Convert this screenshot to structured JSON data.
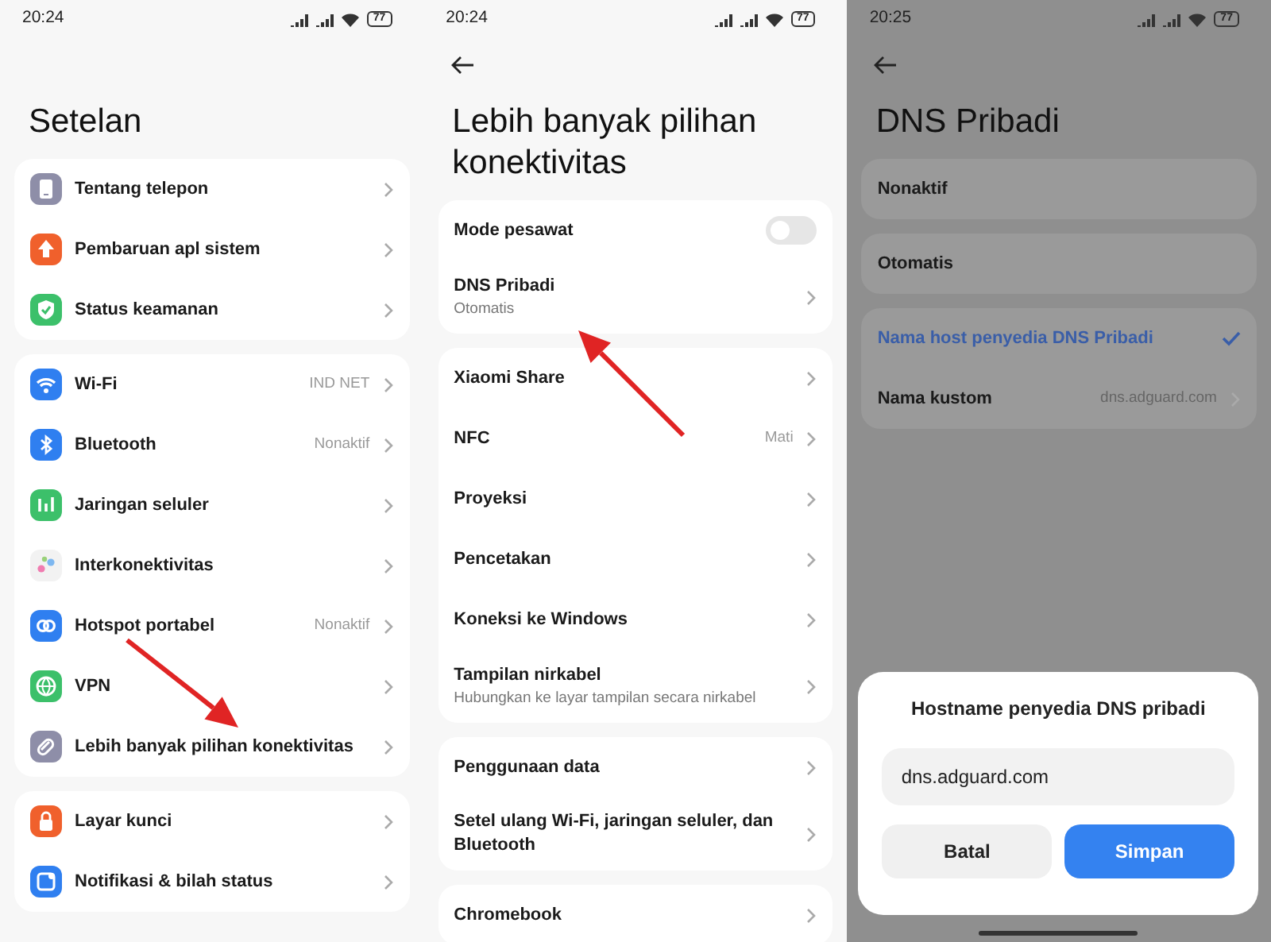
{
  "panels": [
    {
      "status_bar": {
        "time": "20:24",
        "battery": "77"
      },
      "title": "Setelan",
      "groups": [
        [
          {
            "kind": "link",
            "label": "Tentang telepon",
            "color": "#8e8ea8"
          },
          {
            "kind": "link",
            "label": "Pembaruan apl sistem",
            "color": "#f0602c"
          },
          {
            "kind": "link",
            "label": "Status keamanan",
            "color": "#3cc06a"
          }
        ],
        [
          {
            "kind": "link",
            "label": "Wi-Fi",
            "value": "IND NET",
            "color": "#2f7ff0"
          },
          {
            "kind": "link",
            "label": "Bluetooth",
            "value": "Nonaktif",
            "color": "#2f7ff0"
          },
          {
            "kind": "link",
            "label": "Jaringan seluler",
            "color": "#3cc06a"
          },
          {
            "kind": "link",
            "label": "Interkonektivitas",
            "color": "#f2f2f2"
          },
          {
            "kind": "link",
            "label": "Hotspot portabel",
            "value": "Nonaktif",
            "color": "#2f7ff0"
          },
          {
            "kind": "link",
            "label": "VPN",
            "color": "#3cc06a"
          },
          {
            "kind": "link",
            "label": "Lebih banyak pilihan konektivitas",
            "color": "#8e8ea8"
          }
        ],
        [
          {
            "kind": "link",
            "label": "Layar kunci",
            "color": "#f0602c"
          },
          {
            "kind": "link",
            "label": "Notifikasi & bilah status",
            "color": "#2f7ff0"
          }
        ]
      ]
    },
    {
      "status_bar": {
        "time": "20:24",
        "battery": "77"
      },
      "back": true,
      "title": "Lebih banyak pilihan konektivitas",
      "groups": [
        [
          {
            "kind": "toggle",
            "label": "Mode pesawat",
            "on": false
          },
          {
            "kind": "link",
            "label": "DNS Pribadi",
            "subtitle": "Otomatis"
          }
        ],
        [
          {
            "kind": "link",
            "label": "Xiaomi Share"
          },
          {
            "kind": "link",
            "label": "NFC",
            "value": "Mati"
          },
          {
            "kind": "link",
            "label": "Proyeksi"
          },
          {
            "kind": "link",
            "label": "Pencetakan"
          },
          {
            "kind": "link",
            "label": "Koneksi ke Windows"
          },
          {
            "kind": "link",
            "label": "Tampilan nirkabel",
            "subtitle": "Hubungkan ke layar tampilan secara nirkabel"
          }
        ],
        [
          {
            "kind": "link",
            "label": "Penggunaan data"
          },
          {
            "kind": "link",
            "label": "Setel ulang Wi-Fi, jaringan seluler, dan Bluetooth"
          }
        ],
        [
          {
            "kind": "link",
            "label": "Chromebook"
          }
        ]
      ]
    },
    {
      "status_bar": {
        "time": "20:25",
        "battery": "77"
      },
      "back": true,
      "title": "DNS Pribadi",
      "dimmed": true,
      "groups": [
        [
          {
            "kind": "option",
            "label": "Nonaktif",
            "selected": false
          }
        ],
        [
          {
            "kind": "option",
            "label": "Otomatis",
            "selected": false
          }
        ],
        [
          {
            "kind": "option",
            "label": "Nama host penyedia DNS Pribadi",
            "selected": true
          },
          {
            "kind": "link",
            "label": "Nama kustom",
            "value": "dns.adguard.com"
          }
        ]
      ],
      "dialog": {
        "title": "Hostname penyedia DNS pribadi",
        "value": "dns.adguard.com",
        "cancel": "Batal",
        "save": "Simpan"
      }
    }
  ]
}
